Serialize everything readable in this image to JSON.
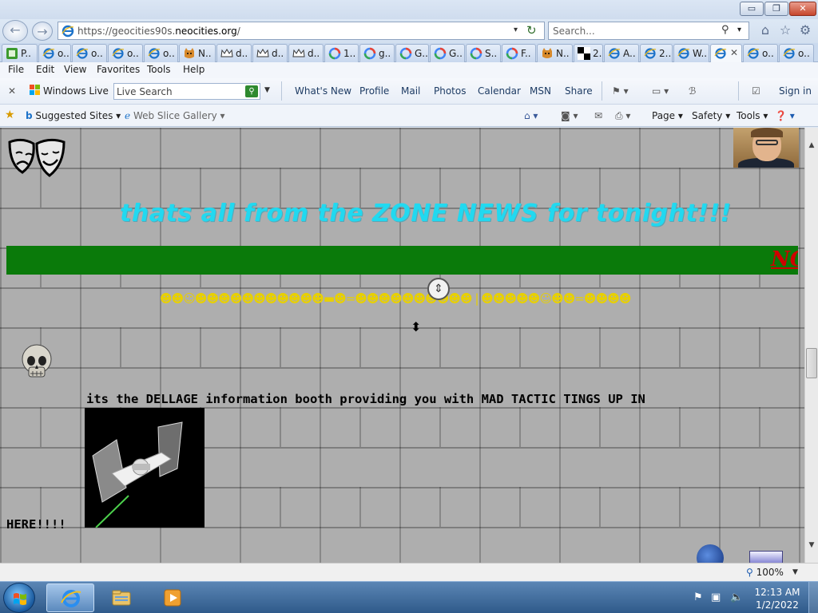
{
  "window": {
    "minimize_glyph": "▭",
    "maximize_glyph": "❐",
    "close_glyph": "✕"
  },
  "nav": {
    "back_glyph": "←",
    "forward_glyph": "→",
    "url_prefix": "https://geocities90s.",
    "url_host": "neocities.org",
    "url_suffix": "/",
    "search_placeholder": "Search...",
    "icons": [
      "home-icon",
      "star-icon",
      "gear-icon"
    ]
  },
  "tabs": [
    {
      "label": "P..",
      "icon": "green-page-icon",
      "active": false
    },
    {
      "label": "o..",
      "icon": "ie-icon",
      "active": false
    },
    {
      "label": "o..",
      "icon": "ie-icon",
      "active": false
    },
    {
      "label": "o..",
      "icon": "ie-icon",
      "active": false
    },
    {
      "label": "o..",
      "icon": "ie-icon",
      "active": false
    },
    {
      "label": "N..",
      "icon": "cat-icon",
      "active": false
    },
    {
      "label": "d..",
      "icon": "crown-icon",
      "active": false
    },
    {
      "label": "d..",
      "icon": "crown-icon",
      "active": false
    },
    {
      "label": "d..",
      "icon": "crown-icon",
      "active": false
    },
    {
      "label": "1..",
      "icon": "google-icon",
      "active": false
    },
    {
      "label": "g..",
      "icon": "google-icon",
      "active": false
    },
    {
      "label": "G..",
      "icon": "google-icon",
      "active": false
    },
    {
      "label": "G..",
      "icon": "google-icon",
      "active": false
    },
    {
      "label": "S..",
      "icon": "google-icon",
      "active": false
    },
    {
      "label": "F..",
      "icon": "google-icon",
      "active": false
    },
    {
      "label": "N..",
      "icon": "cat-icon",
      "active": false
    },
    {
      "label": "2..",
      "icon": "checker-icon",
      "active": false
    },
    {
      "label": "A..",
      "icon": "ie-icon",
      "active": false
    },
    {
      "label": "2..",
      "icon": "ie-icon",
      "active": false
    },
    {
      "label": "W..",
      "icon": "ie-icon",
      "active": false
    },
    {
      "label": "",
      "icon": "ie-icon",
      "active": true
    },
    {
      "label": "o..",
      "icon": "ie-icon",
      "active": false
    },
    {
      "label": "o..",
      "icon": "ie-icon",
      "active": false
    }
  ],
  "menu": [
    "File",
    "Edit",
    "View",
    "Favorites",
    "Tools",
    "Help"
  ],
  "live_toolbar": {
    "close_glyph": "✕",
    "brand": "Windows Live",
    "search_placeholder": "Live Search",
    "links": [
      "What's New",
      "Profile",
      "Mail",
      "Photos",
      "Calendar",
      "MSN",
      "Share"
    ],
    "sign_in": "Sign in"
  },
  "favorites_bar": {
    "suggested": "Suggested Sites",
    "web_slice": "Web Slice Gallery",
    "commands": [
      "Page",
      "Safety",
      "Tools"
    ]
  },
  "page": {
    "zone_news": "thats all from the ZONE NEWS for tonight!!!",
    "marquee": "NO",
    "smileys": "☻☻☺☻☻☻☻☻☻☻☻☻☻☻▬☻=☻☻☻☻☻☻☻☻☻☻ | ☻☻☻☻☻☺☻☻=☻☻☻☻",
    "booth_line": "its the DELLAGE information booth providing you with MAD TACTIC TINGS UP IN",
    "here": "HERE!!!!"
  },
  "status": {
    "zoom": "100%"
  },
  "taskbar": {
    "time": "12:13 AM",
    "date": "1/2/2022"
  },
  "colors": {
    "zone_news": "#21d9f0",
    "green_bar": "#0a7a0a",
    "marquee": "#d00000",
    "brick": "#aeaeae"
  }
}
